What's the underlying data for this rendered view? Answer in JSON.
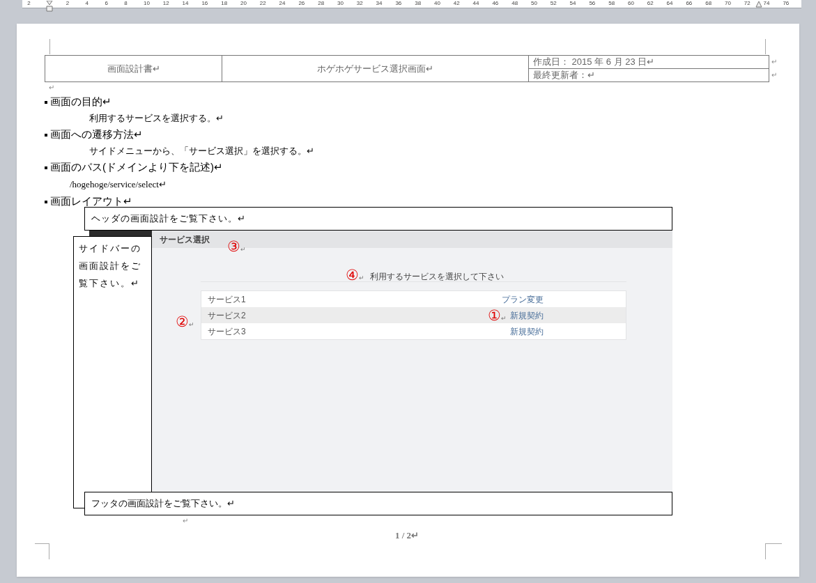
{
  "ruler": {
    "numbers": [
      "2",
      "2",
      "4",
      "6",
      "8",
      "10",
      "12",
      "14",
      "16",
      "18",
      "20",
      "22",
      "24",
      "26",
      "28",
      "30",
      "32",
      "34",
      "36",
      "38",
      "40",
      "42",
      "44",
      "46",
      "48",
      "50",
      "52",
      "54",
      "56",
      "58",
      "60",
      "62",
      "64",
      "66",
      "68",
      "70",
      "72",
      "74",
      "76"
    ]
  },
  "header_table": {
    "doc_type": "画面設計書↵",
    "screen_name": "ホゲホゲサービス選択画面↵",
    "created": "作成日： 2015 年 6 月 23 日↵",
    "updated_by": "最終更新者：↵",
    "row_marks": [
      "↵",
      "↵"
    ]
  },
  "empty_para": "↵",
  "sections": [
    {
      "heading": "画面の目的↵",
      "body": "利用するサービスを選択する。↵",
      "kind": "indent"
    },
    {
      "heading": "画面への遷移方法↵",
      "body": "サイドメニューから、「サービス選択」を選択する。↵",
      "kind": "indent"
    },
    {
      "heading": "画面のパス(ドメインより下を記述)↵",
      "body": "/hogehoge/service/select↵",
      "kind": "path"
    },
    {
      "heading": "画面レイアウト↵",
      "kind": "none"
    }
  ],
  "layout": {
    "header_note": "ヘッダの画面設計をご覧下さい。↵",
    "sidebar_note": "サイドバーの画面設計をご覧下さい。↵",
    "footer_note": "フッタの画面設計をご覧下さい。↵",
    "after_mark": "↵",
    "mockup": {
      "title": "サービス選択",
      "instruction": "利用するサービスを選択して下さい",
      "services": [
        {
          "name": "サービス1",
          "action": "プラン変更",
          "selected": false
        },
        {
          "name": "サービス2",
          "action": "新規契約",
          "selected": true
        },
        {
          "name": "サービス3",
          "action": "新規契約",
          "selected": false
        }
      ]
    },
    "callouts": [
      {
        "label": "③",
        "mark": "↵"
      },
      {
        "label": "④",
        "mark": "↵"
      },
      {
        "label": "②",
        "mark": "↵"
      },
      {
        "label": "①",
        "mark": "↵"
      }
    ]
  },
  "page_number": "1 / 2↵"
}
